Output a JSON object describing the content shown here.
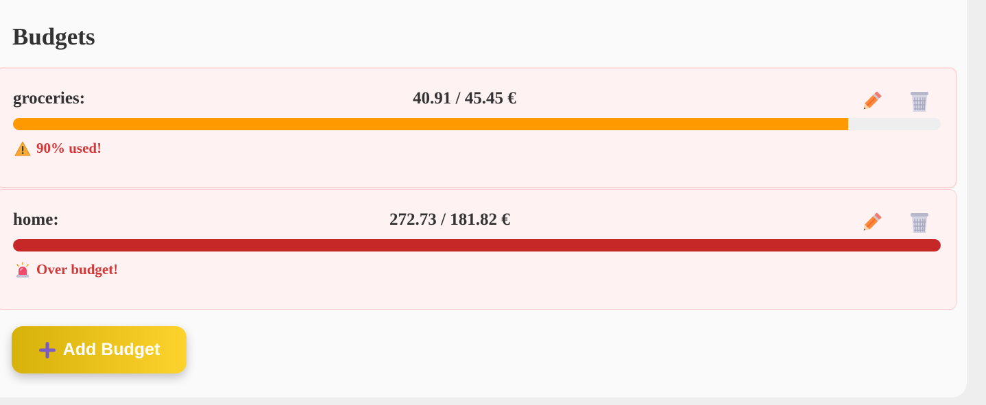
{
  "page": {
    "title": "Budgets"
  },
  "budgets": [
    {
      "category": "groceries:",
      "amount": "40.91 / 45.45 €",
      "used_fraction": 0.9,
      "status_text": "90% used!",
      "status_icon": "warning-icon",
      "bar_color": "#ff9900"
    },
    {
      "category": "home:",
      "amount": "272.73 / 181.82 €",
      "used_fraction": 1.0,
      "status_text": "Over budget!",
      "status_icon": "siren-icon",
      "bar_color": "#c62828"
    }
  ],
  "actions": {
    "edit_icon": "pencil-icon",
    "delete_icon": "trash-icon"
  },
  "add_button": {
    "label": "Add Budget",
    "icon": "plus-icon"
  }
}
